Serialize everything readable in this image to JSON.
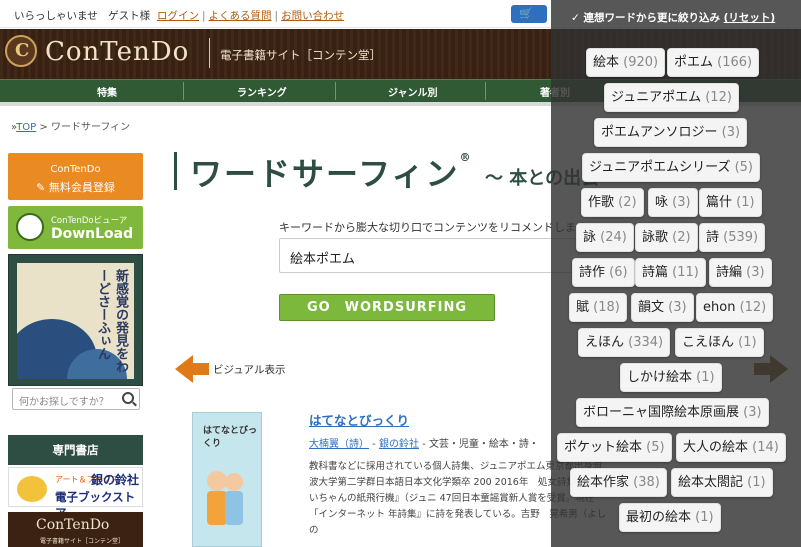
{
  "topbar": {
    "welcome": "いらっしゃいませ　ゲスト様",
    "login": "ログイン",
    "faq": "よくある質問",
    "contact": "お問い合わせ",
    "cart_icon": "cart-icon"
  },
  "header": {
    "logo_text": "ConTenDo",
    "site_label": "電子書籍サイト［コンテン堂］"
  },
  "nav": {
    "items": [
      "特集",
      "ランキング",
      "ジャンル別",
      "著者別"
    ]
  },
  "breadcrumb": {
    "top": "TOP",
    "current": "ワードサーフィン"
  },
  "sidebar": {
    "register_brand": "ConTenDo",
    "register_label": "無料会員登録",
    "viewer_small": "ConTenDoビューア",
    "viewer_big": "DownLoad",
    "banner_text": "新感覚の発見をわーどさーふぃん",
    "search_placeholder": "何かお探しですか？",
    "shop_heading": "専門書店",
    "shop1_small": "アート＆ブックス",
    "shop1_name": "銀の鈴社",
    "shop1_sub": "電子ブックストア",
    "shop2_logo": "ConTenDo",
    "shop2_sub": "電子書籍サイト［コンテン堂］"
  },
  "main": {
    "title": "ワードサーフィン",
    "title_mark": "®",
    "title_sub": "〜 本との出会",
    "intro": "キーワードから膨大な切り口でコンテンツをリコメンドします",
    "keyword": "絵本ポエム",
    "go_button": "GO　WORDSURFING",
    "visual_label": "ビジュアル表示",
    "book": {
      "cover_title": "はてなとびっくり",
      "title": "はてなとびっくり",
      "author": "大楠翼（詩）",
      "publisher": "銀の鈴社",
      "categories": "文芸・児童・絵本・詩・",
      "description": "教科書などに採用されている個人詩集、ジュニアポエム東京都出身筑波大学第二学群日本語日本文化学類卒 200 2016年　処女詩集『おにいちゃんの紙飛行機』（ジュニ 47回日本童謡賞新人賞を受賞。現在「インターネット 年詩集』に詩を発表している。吉野　晃希男（よしの"
    }
  },
  "overlay": {
    "header_check": "✓",
    "header": "連想ワードから更に絞り込み",
    "reset": "(リセット)",
    "chips": [
      {
        "label": "絵本",
        "count": "(920)"
      },
      {
        "label": "ポエム",
        "count": "(166)"
      },
      {
        "label": "ジュニアポエム",
        "count": "(12)"
      },
      {
        "label": "ポエムアンソロジー",
        "count": "(3)"
      },
      {
        "label": "ジュニアポエムシリーズ",
        "count": "(5)"
      },
      {
        "label": "作歌",
        "count": "(2)"
      },
      {
        "label": "咏",
        "count": "(3)"
      },
      {
        "label": "篇什",
        "count": "(1)"
      },
      {
        "label": "詠",
        "count": "(24)"
      },
      {
        "label": "詠歌",
        "count": "(2)"
      },
      {
        "label": "詩",
        "count": "(539)"
      },
      {
        "label": "詩作",
        "count": "(6)"
      },
      {
        "label": "詩篇",
        "count": "(11)"
      },
      {
        "label": "詩編",
        "count": "(3)"
      },
      {
        "label": "賦",
        "count": "(18)"
      },
      {
        "label": "韻文",
        "count": "(3)"
      },
      {
        "label": "ehon",
        "count": "(12)"
      },
      {
        "label": "えほん",
        "count": "(334)"
      },
      {
        "label": "こえほん",
        "count": "(1)"
      },
      {
        "label": "しかけ絵本",
        "count": "(1)"
      },
      {
        "label": "ボローニャ国際絵本原画展",
        "count": "(3)"
      },
      {
        "label": "ポケット絵本",
        "count": "(5)"
      },
      {
        "label": "大人の絵本",
        "count": "(14)"
      },
      {
        "label": "絵本作家",
        "count": "(38)"
      },
      {
        "label": "絵本太閤記",
        "count": "(1)"
      },
      {
        "label": "最初の絵本",
        "count": "(1)"
      }
    ]
  },
  "colors": {
    "header_brown": "#3b2213",
    "nav_green": "#2f5a34",
    "accent_orange": "#e98a23",
    "accent_green": "#7cb83b",
    "link_blue": "#2e6fc0"
  }
}
